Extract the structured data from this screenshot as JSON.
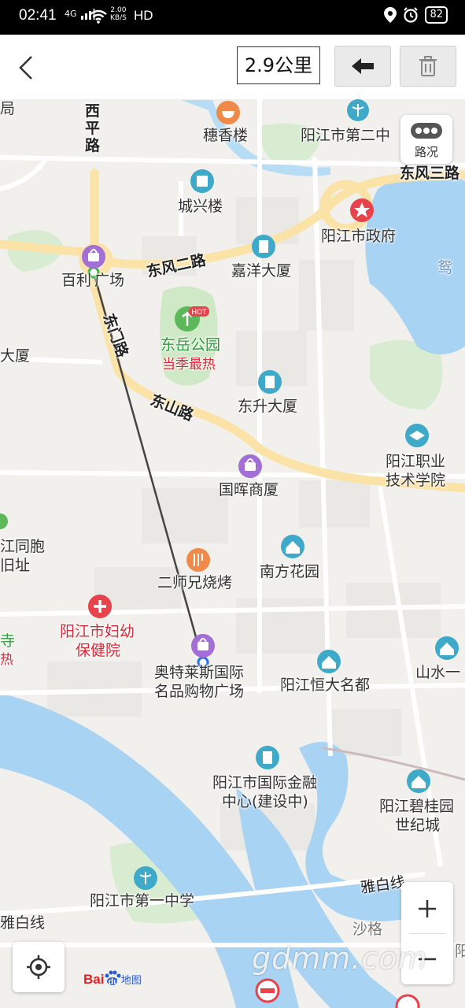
{
  "status_bar": {
    "time": "02:41",
    "network": "4G",
    "speed_value": "2.00",
    "speed_unit": "KB/S",
    "hd": "HD",
    "battery": "82"
  },
  "toolbar": {
    "distance": "2.9公里"
  },
  "map": {
    "traffic_label": "路况",
    "roads": {
      "xiping": "西平路",
      "dongfeng_left": "东风二路",
      "dongfeng_right": "东风三路",
      "dongmen": "东门路",
      "dongshan": "东山路",
      "yabai_right": "雅白线",
      "yabai_left": "雅白线"
    },
    "pois": {
      "suixianglou": "穗香楼",
      "yjdierzhong": "阳江市第二中",
      "chengxinglou": "城兴楼",
      "yjzhengfu": "阳江市政府",
      "baili_line1": "百利",
      "baili_line2": "广场",
      "jiayang": "嘉洋大厦",
      "dongyue": "东岳公园",
      "hot": "当季最热",
      "dongsheng": "东升大厦",
      "yjzhiye_line1": "阳江职业",
      "yjzhiye_line2": "技术学院",
      "guohui": "国晖商厦",
      "ershixiong": "二师兄烧烤",
      "nanfang": "南方花园",
      "fuyou_line1": "阳江市妇幼",
      "fuyou_line2": "保健院",
      "aotelai_line1": "奥特莱斯国际",
      "aotelai_line2": "名品购物广场",
      "hengda": "阳江恒大名都",
      "shanshui": "山水一",
      "jinrong_line1": "阳江市国际金融",
      "jinrong_line2": "中心(建设中)",
      "biguiyuan_line1": "阳江碧桂园",
      "biguiyuan_line2": "世纪城",
      "diyizhongxue": "阳江市第一中学",
      "shage": "沙格",
      "left_dasha": "大厦",
      "left_tongbao_line1": "江同胞",
      "left_tongbao_line2": "旧址",
      "left_si": "寺",
      "left_re": "热",
      "left_top1": "局",
      "yuan_partial": "鸳",
      "yang_partial": "阳"
    },
    "hot_badge": "HOT",
    "baidu_logo_bai": "Bai",
    "baidu_logo_du": "du",
    "baidu_logo_map": "地图",
    "watermark": "gdmm.com",
    "colors": {
      "road_major": "#fbe3a8",
      "water": "#a9d3f3",
      "park": "#d7ecd0",
      "route_line": "#444444",
      "poi_shopping": "#a36fd6",
      "poi_building": "#3fa9c9",
      "poi_food": "#f08a4b",
      "poi_medical": "#e8424c",
      "poi_gov": "#e8424c"
    }
  }
}
